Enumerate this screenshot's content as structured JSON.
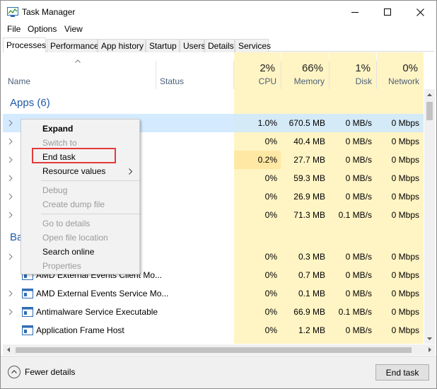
{
  "window": {
    "title": "Task Manager"
  },
  "menu": [
    "File",
    "Options",
    "View"
  ],
  "tabs": [
    "Processes",
    "Performance",
    "App history",
    "Startup",
    "Users",
    "Details",
    "Services"
  ],
  "columns": {
    "name": "Name",
    "status": "Status",
    "cpu": {
      "pct": "2%",
      "label": "CPU"
    },
    "memory": {
      "pct": "66%",
      "label": "Memory"
    },
    "disk": {
      "pct": "1%",
      "label": "Disk"
    },
    "network": {
      "pct": "0%",
      "label": "Network"
    }
  },
  "groups": {
    "apps": "Apps (6)",
    "background_partial": "Ba"
  },
  "rows": [
    {
      "name": "",
      "cpu": "1.0%",
      "memory": "670.5 MB",
      "disk": "0 MB/s",
      "network": "0 Mbps"
    },
    {
      "name": "",
      "cpu": "0%",
      "memory": "40.4 MB",
      "disk": "0 MB/s",
      "network": "0 Mbps"
    },
    {
      "name": "",
      "cpu": "0.2%",
      "memory": "27.7 MB",
      "disk": "0 MB/s",
      "network": "0 Mbps"
    },
    {
      "name": "",
      "cpu": "0%",
      "memory": "59.3 MB",
      "disk": "0 MB/s",
      "network": "0 Mbps"
    },
    {
      "name": "",
      "cpu": "0%",
      "memory": "26.9 MB",
      "disk": "0 MB/s",
      "network": "0 Mbps"
    },
    {
      "name": "",
      "cpu": "0%",
      "memory": "71.3 MB",
      "disk": "0.1 MB/s",
      "network": "0 Mbps"
    },
    {
      "name": "",
      "cpu": "0%",
      "memory": "0.3 MB",
      "disk": "0 MB/s",
      "network": "0 Mbps"
    },
    {
      "name": "AMD External Events Client Mo...",
      "cpu": "0%",
      "memory": "0.7 MB",
      "disk": "0 MB/s",
      "network": "0 Mbps"
    },
    {
      "name": "AMD External Events Service Mo...",
      "cpu": "0%",
      "memory": "0.1 MB",
      "disk": "0 MB/s",
      "network": "0 Mbps"
    },
    {
      "name": "Antimalware Service Executable",
      "cpu": "0%",
      "memory": "66.9 MB",
      "disk": "0.1 MB/s",
      "network": "0 Mbps"
    },
    {
      "name": "Application Frame Host",
      "cpu": "0%",
      "memory": "1.2 MB",
      "disk": "0 MB/s",
      "network": "0 Mbps"
    }
  ],
  "context_menu": {
    "expand": "Expand",
    "switch_to": "Switch to",
    "end_task": "End task",
    "resource_values": "Resource values",
    "debug": "Debug",
    "create_dump": "Create dump file",
    "go_to_details": "Go to details",
    "open_file_location": "Open file location",
    "search_online": "Search online",
    "properties": "Properties"
  },
  "footer": {
    "fewer_details": "Fewer details",
    "end_task": "End task"
  },
  "colors": {
    "highlight_column": "#fff4c4",
    "selected_row": "#cce8ff",
    "group_title": "#1e5aa8",
    "callout_border": "#e23b3b"
  }
}
